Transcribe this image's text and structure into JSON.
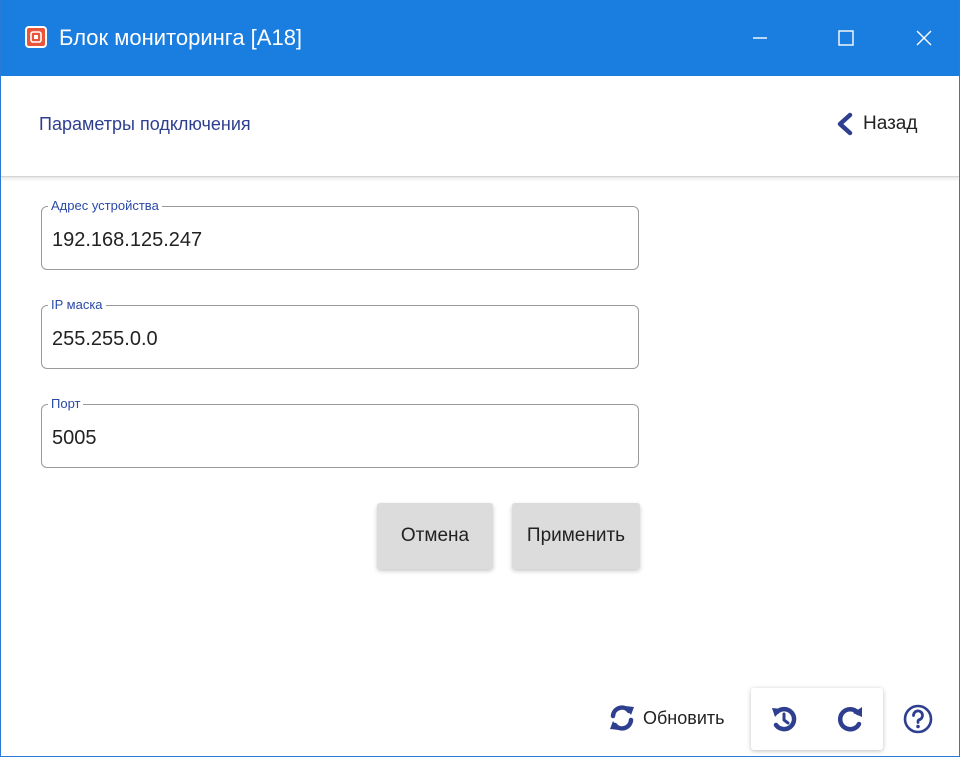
{
  "window": {
    "title": "Блок мониторинга [A18]",
    "accent_color": "#1a7de0",
    "controls": {
      "minimize_icon": "minimize-icon",
      "maximize_icon": "maximize-icon",
      "close_icon": "close-icon"
    }
  },
  "header": {
    "title": "Параметры подключения",
    "back_label": "Назад",
    "back_icon": "chevron-left-icon"
  },
  "form": {
    "address": {
      "label": "Адрес устройства",
      "value": "192.168.125.247"
    },
    "mask": {
      "label": "IP маска",
      "value": "255.255.0.0"
    },
    "port": {
      "label": "Порт",
      "value": "5005"
    }
  },
  "actions": {
    "cancel_label": "Отмена",
    "apply_label": "Применить"
  },
  "footer": {
    "refresh_label": "Обновить",
    "refresh_icon": "refresh-icon",
    "undo_icon": "undo-history-icon",
    "redo_icon": "redo-icon",
    "help_icon": "help-icon"
  }
}
